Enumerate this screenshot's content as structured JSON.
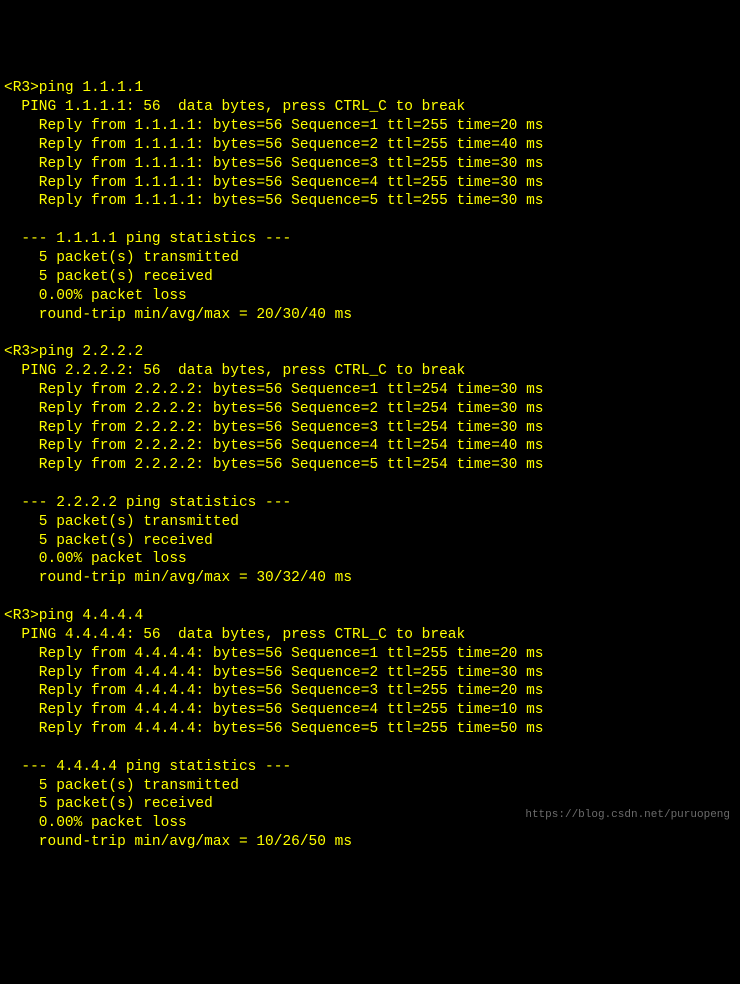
{
  "pings": [
    {
      "prompt": "<R3>",
      "command": "ping 1.1.1.1",
      "header": "  PING 1.1.1.1: 56  data bytes, press CTRL_C to break",
      "replies": [
        "    Reply from 1.1.1.1: bytes=56 Sequence=1 ttl=255 time=20 ms",
        "    Reply from 1.1.1.1: bytes=56 Sequence=2 ttl=255 time=40 ms",
        "    Reply from 1.1.1.1: bytes=56 Sequence=3 ttl=255 time=30 ms",
        "    Reply from 1.1.1.1: bytes=56 Sequence=4 ttl=255 time=30 ms",
        "    Reply from 1.1.1.1: bytes=56 Sequence=5 ttl=255 time=30 ms"
      ],
      "stats_header": "  --- 1.1.1.1 ping statistics ---",
      "stats": [
        "    5 packet(s) transmitted",
        "    5 packet(s) received",
        "    0.00% packet loss",
        "    round-trip min/avg/max = 20/30/40 ms"
      ]
    },
    {
      "prompt": "<R3>",
      "command": "ping 2.2.2.2",
      "header": "  PING 2.2.2.2: 56  data bytes, press CTRL_C to break",
      "replies": [
        "    Reply from 2.2.2.2: bytes=56 Sequence=1 ttl=254 time=30 ms",
        "    Reply from 2.2.2.2: bytes=56 Sequence=2 ttl=254 time=30 ms",
        "    Reply from 2.2.2.2: bytes=56 Sequence=3 ttl=254 time=30 ms",
        "    Reply from 2.2.2.2: bytes=56 Sequence=4 ttl=254 time=40 ms",
        "    Reply from 2.2.2.2: bytes=56 Sequence=5 ttl=254 time=30 ms"
      ],
      "stats_header": "  --- 2.2.2.2 ping statistics ---",
      "stats": [
        "    5 packet(s) transmitted",
        "    5 packet(s) received",
        "    0.00% packet loss",
        "    round-trip min/avg/max = 30/32/40 ms"
      ]
    },
    {
      "prompt": "<R3>",
      "command": "ping 4.4.4.4",
      "header": "  PING 4.4.4.4: 56  data bytes, press CTRL_C to break",
      "replies": [
        "    Reply from 4.4.4.4: bytes=56 Sequence=1 ttl=255 time=20 ms",
        "    Reply from 4.4.4.4: bytes=56 Sequence=2 ttl=255 time=30 ms",
        "    Reply from 4.4.4.4: bytes=56 Sequence=3 ttl=255 time=20 ms",
        "    Reply from 4.4.4.4: bytes=56 Sequence=4 ttl=255 time=10 ms",
        "    Reply from 4.4.4.4: bytes=56 Sequence=5 ttl=255 time=50 ms"
      ],
      "stats_header": "  --- 4.4.4.4 ping statistics ---",
      "stats": [
        "    5 packet(s) transmitted",
        "    5 packet(s) received",
        "    0.00% packet loss",
        "    round-trip min/avg/max = 10/26/50 ms"
      ]
    }
  ],
  "watermark": "https://blog.csdn.net/puruopeng"
}
